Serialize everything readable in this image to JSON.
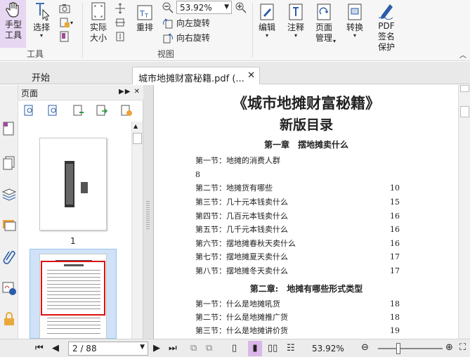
{
  "ribbon": {
    "hand_label": "手型\n工具",
    "select_label": "选择",
    "tools_group_label": "工具",
    "actual_size_label": "实际\n大小",
    "reflow_label": "重排",
    "zoom_value": "53.92%",
    "rotate_left_label": "向左旋转",
    "rotate_right_label": "向右旋转",
    "view_group_label": "视图",
    "edit_label": "编辑",
    "annotate_label": "注释",
    "page_manage_label": "页面\n管理",
    "convert_label": "转换",
    "pdf_sign_label": "PDF\n签名\n保护"
  },
  "tabs": {
    "home_label": "开始",
    "doc_label": "城市地摊财富秘籍.pdf (..."
  },
  "panel": {
    "title": "页面",
    "thumb1_number": "1"
  },
  "document": {
    "title": "《城市地摊财富秘籍》",
    "subtitle": "新版目录",
    "chapter1": "第一章　摆地摊卖什么",
    "chapter2": "第二章:　地摊有哪些形式类型",
    "rows": [
      {
        "label": "第一节：地摊的消费人群",
        "page": ""
      },
      {
        "label": "8",
        "page": ""
      },
      {
        "label": "第二节：地摊货有哪些",
        "page": "10"
      },
      {
        "label": "第三节：几十元本钱卖什么",
        "page": "15"
      },
      {
        "label": "第四节：几百元本钱卖什么",
        "page": "16"
      },
      {
        "label": "第五节：几千元本钱卖什么",
        "page": "16"
      },
      {
        "label": "第六节：摆地摊春秋天卖什么",
        "page": "16"
      },
      {
        "label": "第七节：摆地摊夏天卖什么",
        "page": "17"
      },
      {
        "label": "第八节：摆地摊冬天卖什么",
        "page": "17"
      }
    ],
    "rows2": [
      {
        "label": "第一节：什么是地摊吼货",
        "page": "18"
      },
      {
        "label": "第二节：什么是地摊推广货",
        "page": "18"
      },
      {
        "label": "第三节：什么是地摊讲价货",
        "page": "19"
      }
    ]
  },
  "status": {
    "page_indicator": "2 / 88",
    "zoom_text": "53.92%"
  }
}
